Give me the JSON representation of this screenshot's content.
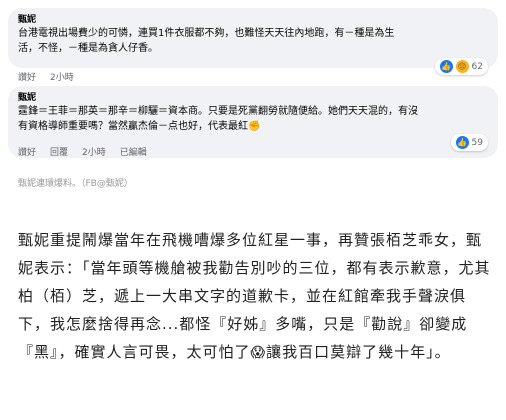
{
  "comments": [
    {
      "author": "甄妮",
      "lines": [
        "台港電視出場費少的可憐，連買1件衣服都不夠，也難怪天天往內地跑，有－種是為生",
        "活，不怪，－種是為貪人仔香。"
      ],
      "actions": {
        "like": "讚好",
        "time": "2小時"
      },
      "reaction_count": "62",
      "reaction_icons": [
        "like-icon",
        "sad-icon"
      ]
    },
    {
      "author": "甄妮",
      "lines": [
        "霆鋒＝王菲＝那英＝那辛＝柳驪＝資本商。只要是死黨翻勞就隨便給。她們天天混的，有沒",
        "有資格導師重要嗎？當然贏杰倫－点也好，代表最紅"
      ],
      "actions": {
        "like": "讚好",
        "reply": "回覆",
        "time": "2小時",
        "edited": "已編輯"
      },
      "reaction_count": "59",
      "reaction_icons": [
        "like-icon"
      ]
    }
  ],
  "caption": "甄妮連環爆料。（FB@甄妮）",
  "article": {
    "text_before_emoji": "甄妮重提鬧爆當年在飛機嘈爆多位紅星一事，再贊張栢芝乖女，甄妮表示：「當年頭等機艙被我勸告別吵的三位，都有表示歉意，尤其柏（栢）芝，遞上一大串文字的道歉卡，並在紅館牽我手聲淚俱下，我怎麼捨得再念...都怪『好姊』多嘴，只是『勸說』卻變成『黑』，確實人言可畏，太可怕了",
    "text_after_emoji": "讓我百口莫辯了幾十年」。",
    "emoji_name": "screaming-face-icon"
  }
}
